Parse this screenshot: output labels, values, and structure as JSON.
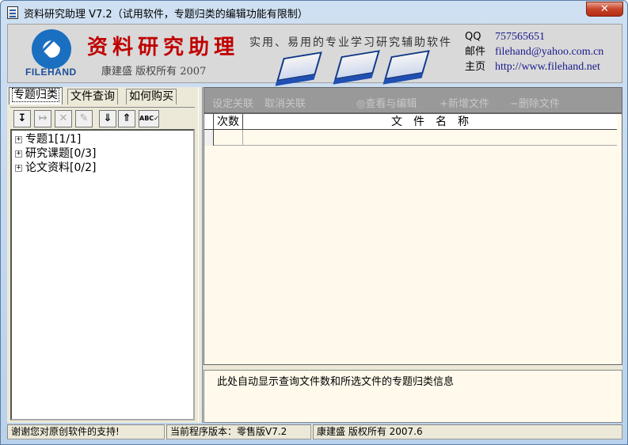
{
  "window": {
    "title": "资料研究助理 V7.2（试用软件，专题归类的编辑功能有限制）",
    "close_label": "✕"
  },
  "banner": {
    "logo_text": "FILEHAND",
    "brand_title": "资料研究助理",
    "copyright": "康建盛 版权所有 2007",
    "slogan": "实用、易用的专业学习研究辅助软件",
    "contact": [
      {
        "label": "QQ",
        "value": "757565651"
      },
      {
        "label": "邮件",
        "value": "filehand@yahoo.com.cn"
      },
      {
        "label": "主页",
        "value": "http://www.filehand.net"
      }
    ]
  },
  "left": {
    "tabs": [
      "专题归类",
      "文件查询",
      "如何购买"
    ],
    "active_tab": 0,
    "toolbar": [
      {
        "icon": "move-down-icon",
        "glyph": "↧",
        "enabled": true
      },
      {
        "icon": "indent-icon",
        "glyph": "↦",
        "enabled": false
      },
      {
        "icon": "delete-icon",
        "glyph": "✕",
        "enabled": false
      },
      {
        "icon": "edit-icon",
        "glyph": "✎",
        "enabled": false
      },
      {
        "icon": "arrow-down-icon",
        "glyph": "⇓",
        "enabled": true
      },
      {
        "icon": "arrow-up-icon",
        "glyph": "⇑",
        "enabled": true
      },
      {
        "icon": "spellcheck-icon",
        "glyph": "ABC✓",
        "enabled": true
      }
    ],
    "tree": [
      {
        "label": "专题1[1/1]"
      },
      {
        "label": "研究课题[0/3]"
      },
      {
        "label": "论文资料[0/2]"
      }
    ]
  },
  "right": {
    "toolbar": [
      "设定关联",
      "取消关联",
      "◎查看与编辑",
      "+新增文件",
      "−删除文件"
    ],
    "grid_headers": [
      "次数",
      "文　件　名　称"
    ],
    "info_text": "此处自动显示查询文件数和所选文件的专题归类信息"
  },
  "statusbar": [
    "谢谢您对原创软件的支持!",
    "当前程序版本：零售版V7.2",
    "康建盛 版权所有 2007.6"
  ]
}
